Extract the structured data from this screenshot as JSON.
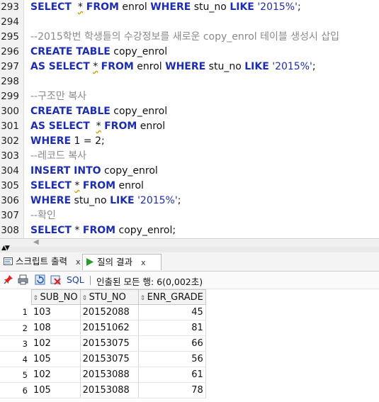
{
  "editor": {
    "lines": [
      {
        "n": "293",
        "segs": [
          [
            "kw",
            "SELECT"
          ],
          [
            "",
            "  "
          ],
          [
            "uline",
            "*"
          ],
          [
            "",
            ""
          ],
          [
            "kw",
            " FROM"
          ],
          [
            "",
            " enrol "
          ],
          [
            "kw",
            "WHERE"
          ],
          [
            "",
            " stu_no "
          ],
          [
            "kw",
            "LIKE"
          ],
          [
            "",
            " "
          ],
          [
            "str",
            "'2015%'"
          ],
          [
            "",
            ";"
          ]
        ]
      },
      {
        "n": "294",
        "segs": []
      },
      {
        "n": "295",
        "segs": [
          [
            "cmt",
            "--2015학번 학생들의 수강정보를 새로운 copy_enrol 테이블 생성시 삽입"
          ]
        ]
      },
      {
        "n": "296",
        "segs": [
          [
            "kw",
            "CREATE TABLE"
          ],
          [
            "",
            " copy_enrol"
          ]
        ]
      },
      {
        "n": "297",
        "segs": [
          [
            "kw",
            "AS SELECT"
          ],
          [
            "",
            " "
          ],
          [
            "uline",
            "*"
          ],
          [
            "",
            " "
          ],
          [
            "kw",
            "FROM"
          ],
          [
            "",
            " enrol "
          ],
          [
            "kw",
            "WHERE"
          ],
          [
            "",
            " stu_no "
          ],
          [
            "kw",
            "LIKE"
          ],
          [
            "",
            " "
          ],
          [
            "str",
            "'2015%'"
          ],
          [
            "",
            ";"
          ]
        ]
      },
      {
        "n": "298",
        "segs": []
      },
      {
        "n": "299",
        "segs": [
          [
            "cmt",
            "--구조만 복사"
          ]
        ]
      },
      {
        "n": "300",
        "segs": [
          [
            "kw",
            "CREATE TABLE"
          ],
          [
            "",
            " copy_enrol"
          ]
        ]
      },
      {
        "n": "301",
        "segs": [
          [
            "kw",
            "AS SELECT"
          ],
          [
            "",
            "  "
          ],
          [
            "uline",
            "*"
          ],
          [
            "",
            " "
          ],
          [
            "kw",
            "FROM"
          ],
          [
            "",
            " enrol"
          ]
        ]
      },
      {
        "n": "302",
        "segs": [
          [
            "kw",
            "WHERE"
          ],
          [
            "",
            " 1 = 2;"
          ]
        ]
      },
      {
        "n": "303",
        "segs": [
          [
            "cmt",
            "--레코드 복사"
          ]
        ]
      },
      {
        "n": "304",
        "segs": [
          [
            "kw",
            "INSERT INTO"
          ],
          [
            "",
            " copy_enrol"
          ]
        ]
      },
      {
        "n": "305",
        "segs": [
          [
            "kw",
            "SELECT"
          ],
          [
            "",
            " "
          ],
          [
            "uline",
            "*"
          ],
          [
            "",
            " "
          ],
          [
            "kw",
            "FROM"
          ],
          [
            "",
            " enrol"
          ]
        ]
      },
      {
        "n": "306",
        "segs": [
          [
            "kw",
            "WHERE"
          ],
          [
            "",
            " stu_no "
          ],
          [
            "kw",
            "LIKE"
          ],
          [
            "",
            " "
          ],
          [
            "str",
            "'2015%'"
          ],
          [
            "",
            ";"
          ]
        ]
      },
      {
        "n": "307",
        "segs": [
          [
            "cmt",
            "--확인"
          ]
        ]
      },
      {
        "n": "308",
        "segs": [
          [
            "kw",
            "SELECT"
          ],
          [
            "",
            " * "
          ],
          [
            "kw",
            "FROM"
          ],
          [
            "",
            " copy_enrol;"
          ]
        ]
      }
    ]
  },
  "tabs": {
    "script_output": "스크립트 출력",
    "query_result": "질의 결과",
    "close": "x"
  },
  "toolbar": {
    "sql_label": "SQL",
    "status": "인출된 모든 행: 6(0,002초)"
  },
  "grid": {
    "columns": [
      "SUB_NO",
      "STU_NO",
      "ENR_GRADE"
    ],
    "rows": [
      {
        "n": "1",
        "sub_no": "103",
        "stu_no": "20152088",
        "grade": "45"
      },
      {
        "n": "2",
        "sub_no": "108",
        "stu_no": "20151062",
        "grade": "81"
      },
      {
        "n": "3",
        "sub_no": "102",
        "stu_no": "20153075",
        "grade": "66"
      },
      {
        "n": "4",
        "sub_no": "105",
        "stu_no": "20153075",
        "grade": "56"
      },
      {
        "n": "5",
        "sub_no": "102",
        "stu_no": "20153088",
        "grade": "61"
      },
      {
        "n": "6",
        "sub_no": "105",
        "stu_no": "20153088",
        "grade": "78"
      }
    ]
  },
  "colors": {
    "keyword": "#1d2db1",
    "comment": "#8a8a8a"
  }
}
